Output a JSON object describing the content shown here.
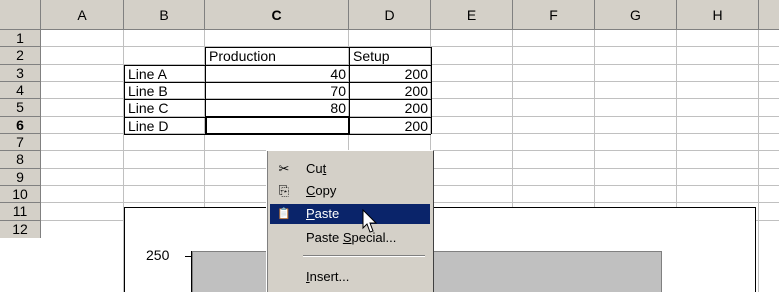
{
  "columns": [
    "A",
    "B",
    "C",
    "D",
    "E",
    "F",
    "G",
    "H"
  ],
  "selected_column": "C",
  "rows": [
    "1",
    "2",
    "3",
    "4",
    "5",
    "6",
    "7",
    "8",
    "9",
    "10",
    "11",
    "12"
  ],
  "selected_row": "6",
  "cells": {
    "C2": "Production",
    "D2": "Setup",
    "B3": "Line A",
    "C3": "40",
    "D3": "200",
    "B4": "Line B",
    "C4": "70",
    "D4": "200",
    "B5": "Line C",
    "C5": "80",
    "D5": "200",
    "B6": "Line D",
    "D6": "200"
  },
  "chart": {
    "axis_label_250": "250"
  },
  "context_menu": {
    "items": [
      {
        "label": "Cut",
        "pre": "Cu",
        "mn": "t",
        "post": "",
        "icon": "scissors-icon",
        "glyph": "✂"
      },
      {
        "label": "Copy",
        "pre": "",
        "mn": "C",
        "post": "opy",
        "icon": "copy-icon",
        "glyph": "⎘"
      },
      {
        "label": "Paste",
        "pre": "",
        "mn": "P",
        "post": "aste",
        "icon": "clipboard-icon",
        "glyph": "📋",
        "highlighted": true
      },
      {
        "label": "Paste Special...",
        "pre": "Paste ",
        "mn": "S",
        "post": "pecial...",
        "icon": "",
        "glyph": ""
      },
      {
        "label": "Insert...",
        "pre": "",
        "mn": "I",
        "post": "nsert...",
        "icon": "",
        "glyph": ""
      }
    ]
  }
}
